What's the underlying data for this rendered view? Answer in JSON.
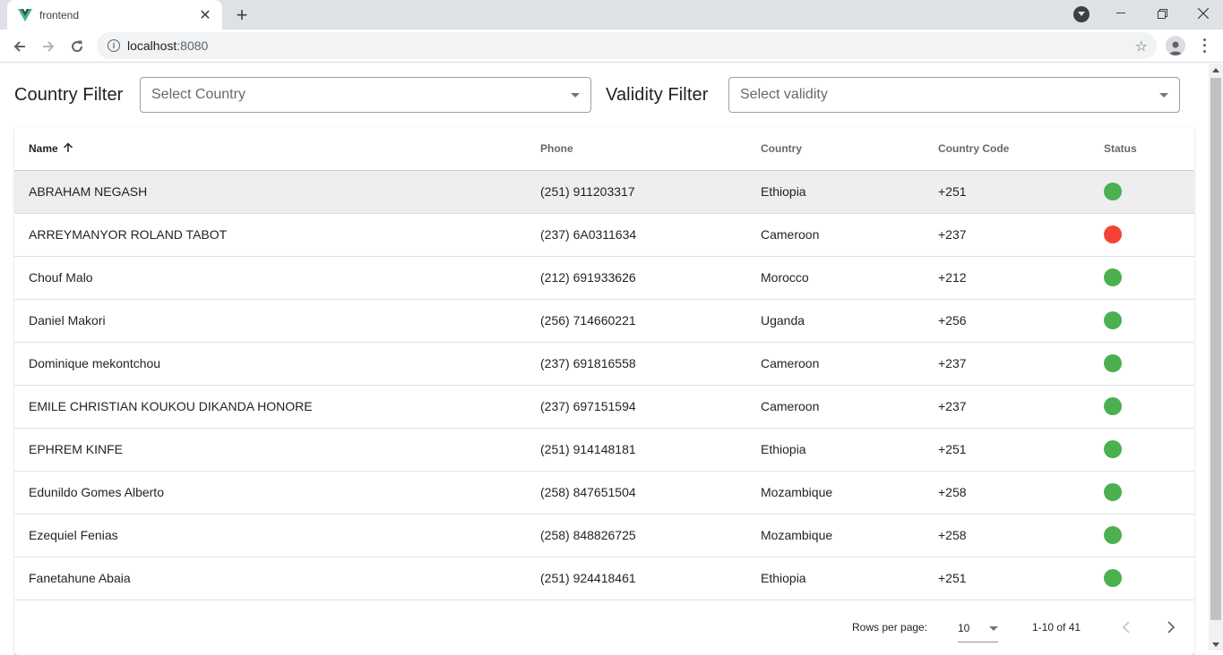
{
  "browser": {
    "tab_title": "frontend",
    "url_host": "localhost",
    "url_port": ":8080"
  },
  "filters": {
    "country_label": "Country Filter",
    "country_placeholder": "Select Country",
    "validity_label": "Validity Filter",
    "validity_placeholder": "Select validity"
  },
  "table": {
    "headers": [
      "Name",
      "Phone",
      "Country",
      "Country Code",
      "Status"
    ],
    "rows": [
      {
        "name": "ABRAHAM NEGASH",
        "phone": "(251) 911203317",
        "country": "Ethiopia",
        "code": "+251",
        "status": "valid"
      },
      {
        "name": "ARREYMANYOR ROLAND TABOT",
        "phone": "(237) 6A0311634",
        "country": "Cameroon",
        "code": "+237",
        "status": "invalid"
      },
      {
        "name": "Chouf Malo",
        "phone": "(212) 691933626",
        "country": "Morocco",
        "code": "+212",
        "status": "valid"
      },
      {
        "name": "Daniel Makori",
        "phone": "(256) 714660221",
        "country": "Uganda",
        "code": "+256",
        "status": "valid"
      },
      {
        "name": "Dominique mekontchou",
        "phone": "(237) 691816558",
        "country": "Cameroon",
        "code": "+237",
        "status": "valid"
      },
      {
        "name": "EMILE CHRISTIAN KOUKOU DIKANDA HONORE",
        "phone": "(237) 697151594",
        "country": "Cameroon",
        "code": "+237",
        "status": "valid"
      },
      {
        "name": "EPHREM KINFE",
        "phone": "(251) 914148181",
        "country": "Ethiopia",
        "code": "+251",
        "status": "valid"
      },
      {
        "name": "Edunildo Gomes Alberto",
        "phone": "(258) 847651504",
        "country": "Mozambique",
        "code": "+258",
        "status": "valid"
      },
      {
        "name": "Ezequiel Fenias",
        "phone": "(258) 848826725",
        "country": "Mozambique",
        "code": "+258",
        "status": "valid"
      },
      {
        "name": "Fanetahune Abaia",
        "phone": "(251) 924418461",
        "country": "Ethiopia",
        "code": "+251",
        "status": "valid"
      }
    ]
  },
  "status_colors": {
    "valid": "#4caf50",
    "invalid": "#f44336"
  },
  "footer": {
    "rows_per_page_label": "Rows per page:",
    "rows_per_page_value": "10",
    "range_text": "1-10 of 41"
  }
}
